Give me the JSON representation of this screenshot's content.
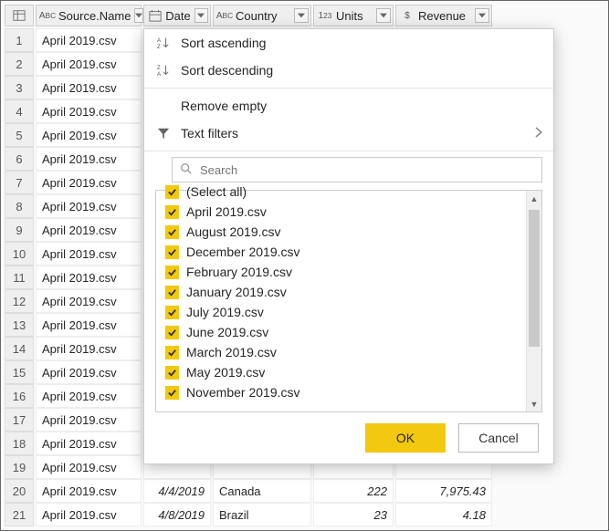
{
  "columns": {
    "source_name": "Source.Name",
    "date": "Date",
    "country": "Country",
    "units": "Units",
    "revenue": "Revenue"
  },
  "rows": [
    {
      "n": 1,
      "src": "April 2019.csv",
      "date": "",
      "country": "",
      "units": "",
      "rev": ""
    },
    {
      "n": 2,
      "src": "April 2019.csv",
      "date": "",
      "country": "",
      "units": "",
      "rev": ""
    },
    {
      "n": 3,
      "src": "April 2019.csv",
      "date": "",
      "country": "",
      "units": "",
      "rev": ""
    },
    {
      "n": 4,
      "src": "April 2019.csv",
      "date": "",
      "country": "",
      "units": "",
      "rev": ""
    },
    {
      "n": 5,
      "src": "April 2019.csv",
      "date": "",
      "country": "",
      "units": "",
      "rev": ""
    },
    {
      "n": 6,
      "src": "April 2019.csv",
      "date": "",
      "country": "",
      "units": "",
      "rev": ""
    },
    {
      "n": 7,
      "src": "April 2019.csv",
      "date": "",
      "country": "",
      "units": "",
      "rev": ""
    },
    {
      "n": 8,
      "src": "April 2019.csv",
      "date": "",
      "country": "",
      "units": "",
      "rev": ""
    },
    {
      "n": 9,
      "src": "April 2019.csv",
      "date": "",
      "country": "",
      "units": "",
      "rev": ""
    },
    {
      "n": 10,
      "src": "April 2019.csv",
      "date": "",
      "country": "",
      "units": "",
      "rev": ""
    },
    {
      "n": 11,
      "src": "April 2019.csv",
      "date": "",
      "country": "",
      "units": "",
      "rev": ""
    },
    {
      "n": 12,
      "src": "April 2019.csv",
      "date": "",
      "country": "",
      "units": "",
      "rev": ""
    },
    {
      "n": 13,
      "src": "April 2019.csv",
      "date": "",
      "country": "",
      "units": "",
      "rev": ""
    },
    {
      "n": 14,
      "src": "April 2019.csv",
      "date": "",
      "country": "",
      "units": "",
      "rev": ""
    },
    {
      "n": 15,
      "src": "April 2019.csv",
      "date": "",
      "country": "",
      "units": "",
      "rev": ""
    },
    {
      "n": 16,
      "src": "April 2019.csv",
      "date": "",
      "country": "",
      "units": "",
      "rev": ""
    },
    {
      "n": 17,
      "src": "April 2019.csv",
      "date": "",
      "country": "",
      "units": "",
      "rev": ""
    },
    {
      "n": 18,
      "src": "April 2019.csv",
      "date": "",
      "country": "",
      "units": "",
      "rev": ""
    },
    {
      "n": 19,
      "src": "April 2019.csv",
      "date": "",
      "country": "",
      "units": "",
      "rev": ""
    },
    {
      "n": 20,
      "src": "April 2019.csv",
      "date": "4/4/2019",
      "country": "Canada",
      "units": "222",
      "rev": "7,975.43"
    },
    {
      "n": 21,
      "src": "April 2019.csv",
      "date": "4/8/2019",
      "country": "Brazil",
      "units": "23",
      "rev": "4.18"
    }
  ],
  "popup": {
    "sort_asc": "Sort ascending",
    "sort_desc": "Sort descending",
    "remove_empty": "Remove empty",
    "text_filters": "Text filters",
    "search_placeholder": "Search",
    "filter_items": [
      "(Select all)",
      "April 2019.csv",
      "August 2019.csv",
      "December 2019.csv",
      "February 2019.csv",
      "January 2019.csv",
      "July 2019.csv",
      "June 2019.csv",
      "March 2019.csv",
      "May 2019.csv",
      "November 2019.csv"
    ],
    "ok": "OK",
    "cancel": "Cancel"
  },
  "colors": {
    "accent": "#f2c811"
  }
}
